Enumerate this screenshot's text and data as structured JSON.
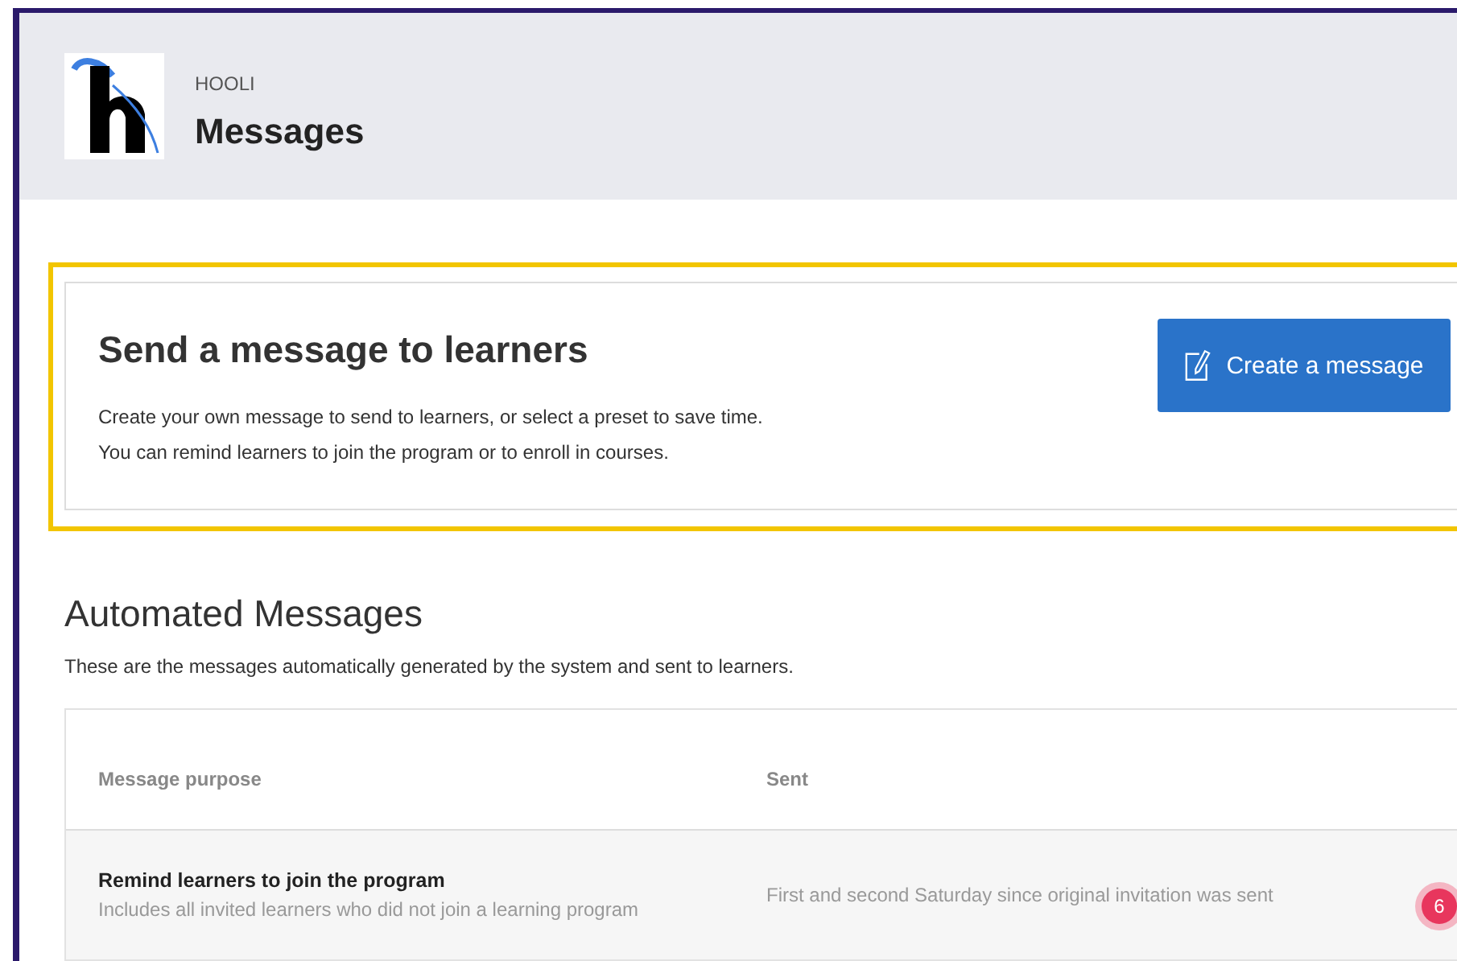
{
  "header": {
    "organization": "HOOLI",
    "title": "Messages"
  },
  "send_card": {
    "title": "Send a message to learners",
    "description_lines": [
      "Create your own message to send to learners, or select a preset to save time.",
      "You can remind learners to join the program or to enroll in courses."
    ],
    "button": "Create a message"
  },
  "automated": {
    "title": "Automated Messages",
    "description": "These are the messages automatically generated by the system and sent to learners.",
    "table": {
      "columns": [
        "Message purpose",
        "Sent"
      ],
      "rows": [
        {
          "purpose": "Remind learners to join the program",
          "details": "Includes all invited learners who did not join a learning program",
          "sent": "First and second Saturday since original invitation was sent"
        }
      ]
    }
  },
  "notification_badge": "6"
}
